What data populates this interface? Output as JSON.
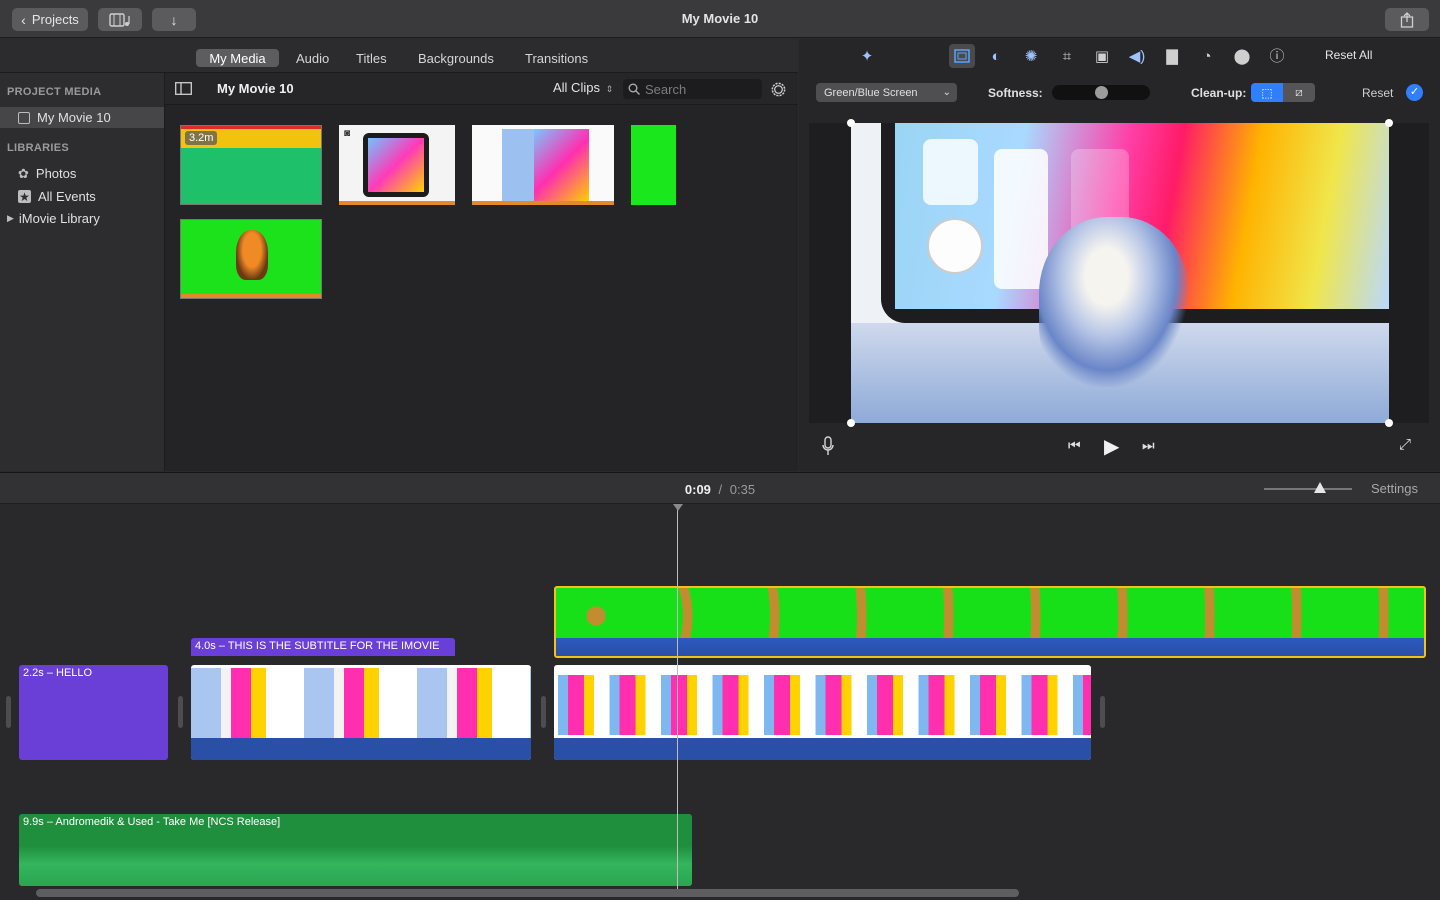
{
  "window": {
    "title": "My Movie 10"
  },
  "toolbar": {
    "projects_label": "Projects"
  },
  "browser_tabs": [
    "My Media",
    "Audio",
    "Titles",
    "Backgrounds",
    "Transitions"
  ],
  "sidebar": {
    "project_media_header": "PROJECT MEDIA",
    "project_item": "My Movie 10",
    "libraries_header": "LIBRARIES",
    "items": [
      "Photos",
      "All Events",
      "iMovie Library"
    ]
  },
  "media": {
    "event_title": "My Movie 10",
    "filter": "All Clips",
    "search_placeholder": "Search",
    "clip1_duration": "3.2m"
  },
  "inspector": {
    "reset_all": "Reset All",
    "effect_select": "Green/Blue Screen",
    "softness_label": "Softness:",
    "cleanup_label": "Clean-up:",
    "reset_label": "Reset"
  },
  "timeline": {
    "current_time": "0:09",
    "separator": "/",
    "total_time": "0:35",
    "settings_label": "Settings",
    "title_clip": "2.2s – HELLO",
    "subtitle_clip": "4.0s – THIS IS THE SUBTITLE FOR THE IMOVIE",
    "music_clip": "9.9s – Andromedik & Used - Take Me [NCS Release]"
  },
  "colors": {
    "accent": "#2f7fff",
    "green_screen": "#19e01a",
    "title_purple": "#6a3fd8",
    "audio_green": "#1f8f3e"
  }
}
